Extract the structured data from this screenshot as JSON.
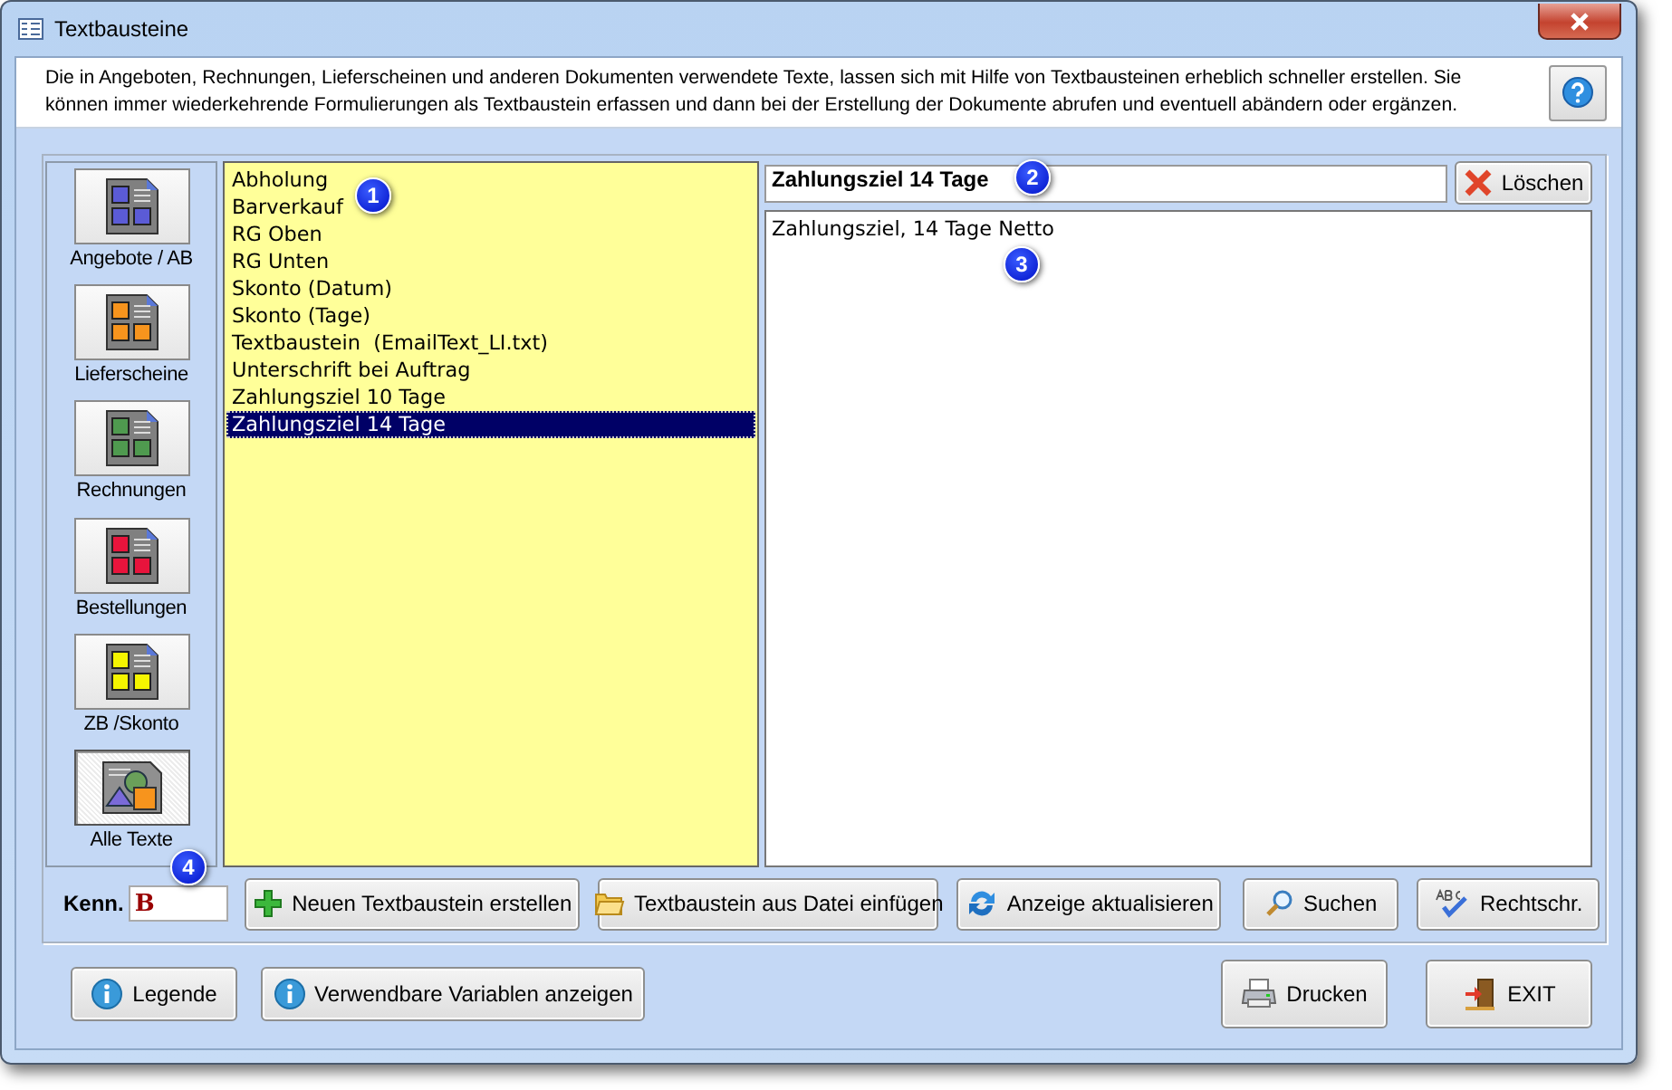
{
  "window": {
    "title": "Textbausteine"
  },
  "info": {
    "text": "Die in Angeboten, Rechnungen, Lieferscheinen und anderen Dokumenten verwendete Texte, lassen sich mit Hilfe von Textbausteinen erheblich schneller erstellen. Sie können immer wiederkehrende Formulierungen als Textbaustein erfassen und dann bei der Erstellung der Dokumente abrufen und eventuell abändern oder ergänzen."
  },
  "categories": [
    {
      "label": "Angebote / AB",
      "kind": "grid",
      "color": "#5b5bd6",
      "selected": false
    },
    {
      "label": "Lieferscheine",
      "kind": "grid",
      "color": "#f7941d",
      "selected": false
    },
    {
      "label": "Rechnungen",
      "kind": "grid",
      "color": "#4f9a4f",
      "selected": false
    },
    {
      "label": "Bestellungen",
      "kind": "grid",
      "color": "#e8143c",
      "selected": false
    },
    {
      "label": "ZB /Skonto",
      "kind": "grid",
      "color": "#f5f500",
      "selected": false
    },
    {
      "label": "Alle Texte",
      "kind": "shapes",
      "selected": true
    }
  ],
  "list": {
    "items": [
      {
        "label": "Abholung",
        "selected": false
      },
      {
        "label": "Barverkauf",
        "selected": false
      },
      {
        "label": "RG Oben",
        "selected": false
      },
      {
        "label": "RG Unten",
        "selected": false
      },
      {
        "label": "Skonto (Datum)",
        "selected": false
      },
      {
        "label": "Skonto (Tage)",
        "selected": false
      },
      {
        "label": "Textbaustein  (EmailText_LI.txt)",
        "selected": false
      },
      {
        "label": "Unterschrift bei Auftrag",
        "selected": false
      },
      {
        "label": "Zahlungsziel 10 Tage",
        "selected": false
      },
      {
        "label": "Zahlungsziel 14 Tage",
        "selected": true
      }
    ]
  },
  "editor": {
    "title": "Zahlungsziel 14 Tage",
    "delete_button": "Löschen",
    "body": "Zahlungsziel, 14 Tage Netto"
  },
  "kenn": {
    "label": "Kenn.",
    "value": "B"
  },
  "toolbar": [
    {
      "label": "Neuen Textbaustein erstellen",
      "kind": "plus"
    },
    {
      "label": "Textbaustein aus Datei einfügen",
      "kind": "folder"
    },
    {
      "label": "Anzeige aktualisieren",
      "kind": "refresh"
    },
    {
      "label": "Suchen",
      "kind": "search"
    },
    {
      "label": "Rechtschr.",
      "kind": "spell"
    }
  ],
  "footer": [
    {
      "label": "Legende",
      "kind": "info"
    },
    {
      "label": "Verwendbare Variablen anzeigen",
      "kind": "info"
    },
    {
      "label": "Drucken",
      "kind": "print"
    },
    {
      "label": "EXIT",
      "kind": "exit"
    }
  ],
  "callouts": [
    "1",
    "2",
    "3",
    "4"
  ]
}
